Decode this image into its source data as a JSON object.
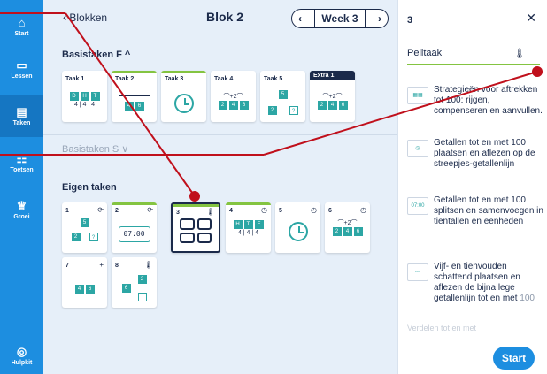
{
  "nav": {
    "items": [
      {
        "label": "Start",
        "icon": "home-icon"
      },
      {
        "label": "Lessen",
        "icon": "presentation-icon"
      },
      {
        "label": "Taken",
        "icon": "tasks-icon",
        "active": true
      },
      {
        "label": "Toetsen",
        "icon": "test-icon"
      },
      {
        "label": "Groei",
        "icon": "growth-icon"
      }
    ],
    "help": {
      "label": "Hulpkit",
      "icon": "lifebuoy-icon"
    }
  },
  "header": {
    "back_label": "Blokken",
    "title": "Blok 2",
    "week": "Week 3"
  },
  "sections": {
    "basis_f": "Basistaken F ^",
    "basis_s": "Basistaken S ∨",
    "eigen": "Eigen taken"
  },
  "basis_cards": [
    {
      "label": "Taak 1"
    },
    {
      "label": "Taak 2"
    },
    {
      "label": "Taak 3"
    },
    {
      "label": "Taak 4"
    },
    {
      "label": "Taak 5"
    },
    {
      "label": "Extra 1"
    }
  ],
  "eigen_cards": [
    {
      "label": "1",
      "tag": "⟳"
    },
    {
      "label": "2",
      "tag": "⟳",
      "thumb": "07:00"
    },
    {
      "label": "3",
      "tag": "🌡"
    },
    {
      "label": "4",
      "tag": "◷"
    },
    {
      "label": "5",
      "tag": "◴"
    },
    {
      "label": "6",
      "tag": "◴"
    },
    {
      "label": "7",
      "tag": "+"
    },
    {
      "label": "8",
      "tag": "🌡"
    }
  ],
  "panel": {
    "number": "3",
    "subtitle": "Peiltaak",
    "items": [
      {
        "text": "Strategieën voor aftrekken tot 100: rijgen, compenseren en aanvullen."
      },
      {
        "text": "Getallen tot en met 100 plaatsen en aflezen op de streepjes-getallenlijn"
      },
      {
        "text": "Getallen tot en met 100 splitsen en samenvoegen in tientallen en eenheden",
        "icon_text": "07:00"
      },
      {
        "text": "Vijf- en tienvouden schattend plaatsen en aflezen de bijna lege getallenlijn tot en met",
        "tail": "100"
      }
    ],
    "faded": "Verdelen tot en met",
    "start": "Start"
  },
  "colors": {
    "nav": "#1d8ee0",
    "nav_active": "#1576c2",
    "accent_green": "#84c441",
    "teal": "#2ca6a4",
    "annotation": "#c0101c"
  }
}
